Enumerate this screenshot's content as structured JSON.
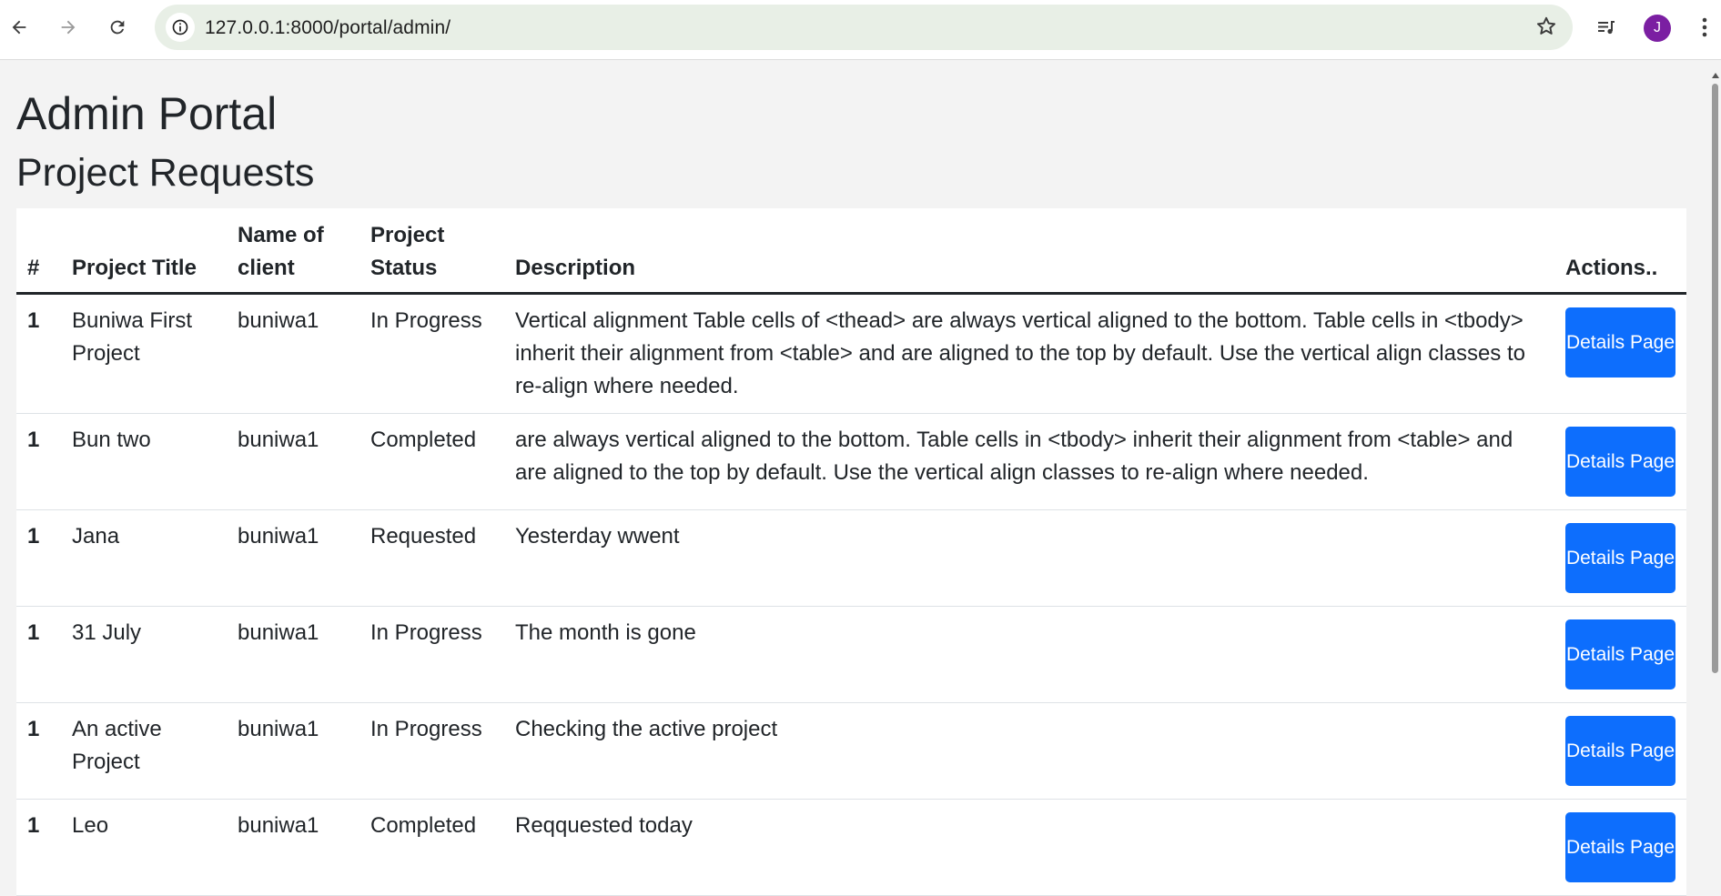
{
  "browser": {
    "url": "127.0.0.1:8000/portal/admin/",
    "profile_initial": "J",
    "accent": "#7b1fa2"
  },
  "page": {
    "title": "Admin Portal",
    "section_title": "Project Requests"
  },
  "table": {
    "headers": {
      "num": "#",
      "title": "Project Title",
      "client": "Name of client",
      "status": "Project Status",
      "description": "Description",
      "actions": "Actions.."
    },
    "rows": [
      {
        "num": "1",
        "title": "Buniwa First Project",
        "client": "buniwa1",
        "status": "In Progress",
        "description": "Vertical alignment Table cells of <thead> are always vertical aligned to the bottom. Table cells in <tbody> inherit their alignment from <table> and are aligned to the top by default. Use the vertical align classes to re-align where needed.",
        "action": "Details Page"
      },
      {
        "num": "1",
        "title": "Bun two",
        "client": "buniwa1",
        "status": "Completed",
        "description": "are always vertical aligned to the bottom. Table cells in <tbody> inherit their alignment from <table> and are aligned to the top by default. Use the vertical align classes to re-align where needed.",
        "action": "Details Page"
      },
      {
        "num": "1",
        "title": "Jana",
        "client": "buniwa1",
        "status": "Requested",
        "description": "Yesterday wwent",
        "action": "Details Page"
      },
      {
        "num": "1",
        "title": "31 July",
        "client": "buniwa1",
        "status": "In Progress",
        "description": "The month is gone",
        "action": "Details Page"
      },
      {
        "num": "1",
        "title": "An active Project",
        "client": "buniwa1",
        "status": "In Progress",
        "description": "Checking the active project",
        "action": "Details Page"
      },
      {
        "num": "1",
        "title": "Leo",
        "client": "buniwa1",
        "status": "Completed",
        "description": "Reqquested today",
        "action": "Details Page"
      }
    ]
  },
  "colors": {
    "button": "#0d6efd",
    "page_bg": "#f3f3f3",
    "table_bg": "#ffffff"
  },
  "icons": [
    "back-arrow-icon",
    "forward-arrow-icon",
    "reload-icon",
    "site-info-icon",
    "bookmark-star-icon",
    "media-queue-icon",
    "kebab-menu-icon"
  ]
}
